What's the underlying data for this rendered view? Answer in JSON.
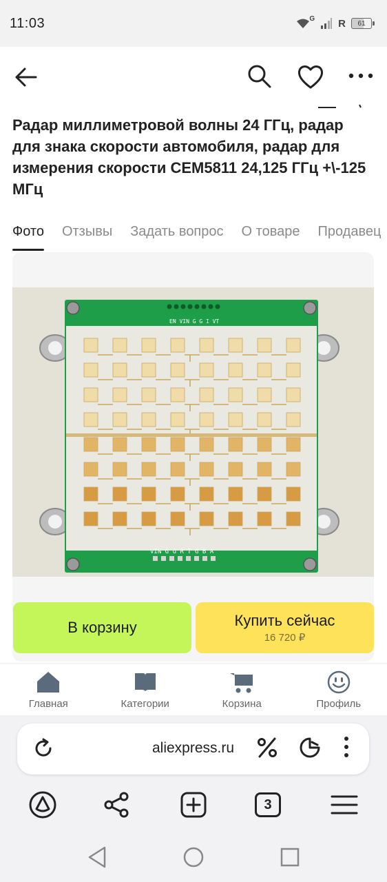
{
  "status_bar": {
    "time": "11:03",
    "network_letter": "R",
    "signal_badge": "G",
    "battery": "61"
  },
  "app_bar": {
    "icons": [
      "back-arrow-icon",
      "search-icon",
      "heart-icon",
      "more-icon"
    ]
  },
  "product": {
    "title": "Радар миллиметровой волны 24 ГГц, радар для знака скорости автомобиля, радар для измерения скорости CEM5811 24,125 ГГц +\\-125 МГц"
  },
  "tabs": [
    {
      "label": "Фото",
      "active": true
    },
    {
      "label": "Отзывы",
      "active": false
    },
    {
      "label": "Задать вопрос",
      "active": false
    },
    {
      "label": "О товаре",
      "active": false
    },
    {
      "label": "Продавец",
      "active": false
    }
  ],
  "photo": {
    "board_top_label": "EN VIN G  G  I  VT",
    "board_bottom_label": "VIN  G  G  R  T  G  B  A",
    "pcb_green": "#1f9e4a",
    "panel_color": "#e9e9e2",
    "pad_color": "#e8c77a"
  },
  "actions": {
    "add_to_cart": "В корзину",
    "buy_now": "Купить сейчас",
    "price": "16 720 ₽",
    "cart_color": "#c4f65a",
    "buy_color": "#fde25a"
  },
  "site_nav": [
    {
      "label": "Главная",
      "icon": "home-icon"
    },
    {
      "label": "Категории",
      "icon": "catalog-book-icon"
    },
    {
      "label": "Корзина",
      "icon": "cart-icon"
    },
    {
      "label": "Профиль",
      "icon": "smiley-profile-icon"
    }
  ],
  "browser": {
    "url": "aliexpress.ru",
    "tabs_count": "3"
  }
}
